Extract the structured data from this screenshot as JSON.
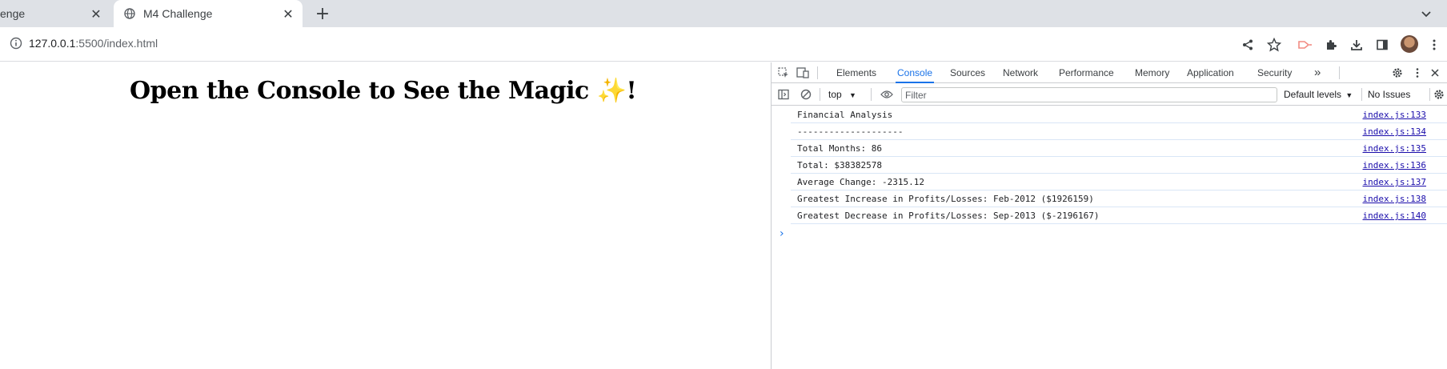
{
  "browser": {
    "tabs": [
      {
        "title": "enge",
        "active": false
      },
      {
        "title": "M4 Challenge",
        "active": true
      }
    ],
    "url_host": "127.0.0.1",
    "url_path": ":5500/index.html"
  },
  "page": {
    "heading": "Open the Console to See the Magic ✨!"
  },
  "devtools": {
    "tabs": [
      "Elements",
      "Console",
      "Sources",
      "Network",
      "Performance",
      "Memory",
      "Application",
      "Security"
    ],
    "more_tabs": "»",
    "active_tab": "Console",
    "context": "top",
    "filter_placeholder": "Filter",
    "levels": "Default levels",
    "issues": "No Issues",
    "logs": [
      {
        "message": "Financial Analysis",
        "source": "index.js:133"
      },
      {
        "message": "--------------------",
        "source": "index.js:134"
      },
      {
        "message": "Total Months: 86",
        "source": "index.js:135"
      },
      {
        "message": "Total: $38382578",
        "source": "index.js:136"
      },
      {
        "message": "Average Change: -2315.12",
        "source": "index.js:137"
      },
      {
        "message": "Greatest Increase in Profits/Losses: Feb-2012 ($1926159)",
        "source": "index.js:138"
      },
      {
        "message": "Greatest Decrease in Profits/Losses: Sep-2013 ($-2196167)",
        "source": "index.js:140"
      }
    ],
    "prompt": "›"
  },
  "colors": {
    "accent": "#1a73e8",
    "link": "#1a0dab",
    "tabstrip": "#dee1e6"
  }
}
